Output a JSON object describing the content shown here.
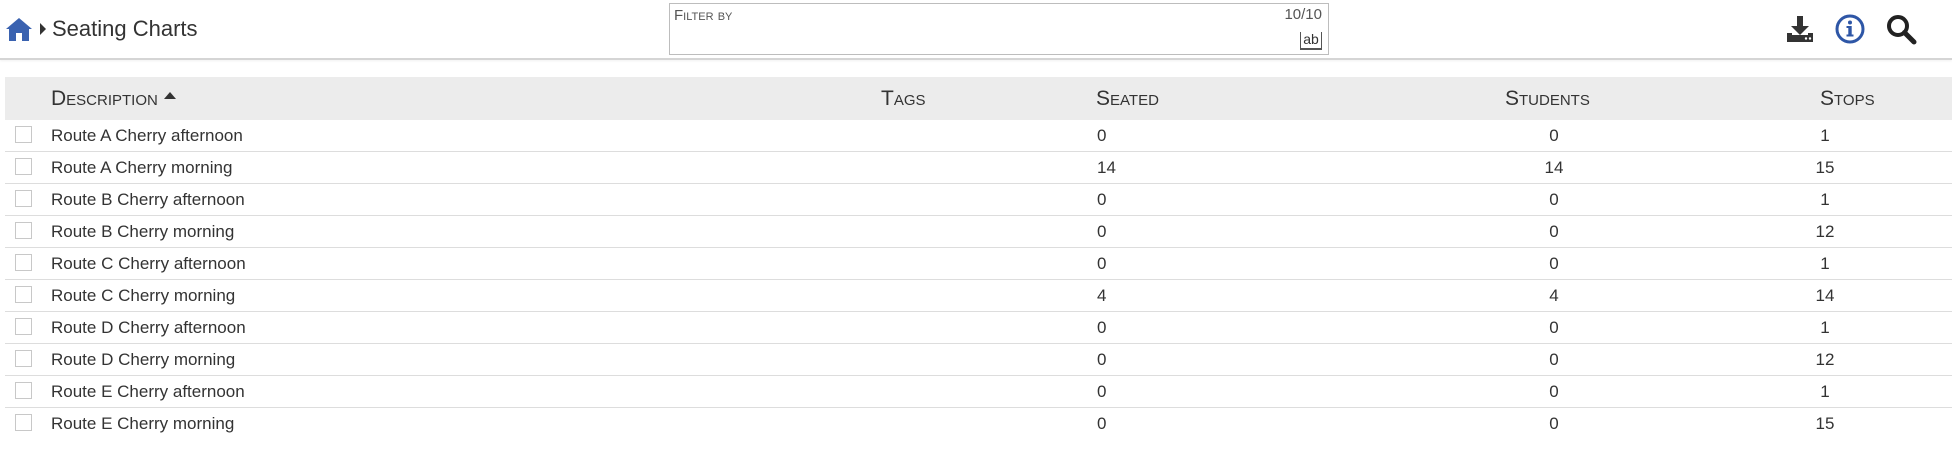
{
  "breadcrumb": {
    "home_icon": "home-icon",
    "separator_icon": "caret-right-icon",
    "title": "Seating Charts"
  },
  "filter": {
    "label": "Filter by",
    "count": "10/10",
    "value": "",
    "mode_icon": "match-case-ab-icon",
    "mode_text": "ab"
  },
  "toolbar": {
    "icons": [
      "download-icon",
      "info-icon",
      "search-icon"
    ]
  },
  "table": {
    "columns": {
      "description": "Description",
      "tags": "Tags",
      "seated": "Seated",
      "students": "Students",
      "stops": "Stops"
    },
    "sort": {
      "column": "description",
      "direction": "ascending"
    },
    "rows": [
      {
        "description": "Route A Cherry afternoon",
        "tags": "",
        "seated": "0",
        "students": "0",
        "stops": "1"
      },
      {
        "description": "Route A Cherry morning",
        "tags": "",
        "seated": "14",
        "students": "14",
        "stops": "15"
      },
      {
        "description": "Route B Cherry afternoon",
        "tags": "",
        "seated": "0",
        "students": "0",
        "stops": "1"
      },
      {
        "description": "Route B Cherry morning",
        "tags": "",
        "seated": "0",
        "students": "0",
        "stops": "12"
      },
      {
        "description": "Route C Cherry afternoon",
        "tags": "",
        "seated": "0",
        "students": "0",
        "stops": "1"
      },
      {
        "description": "Route C Cherry morning",
        "tags": "",
        "seated": "4",
        "students": "4",
        "stops": "14"
      },
      {
        "description": "Route D Cherry afternoon",
        "tags": "",
        "seated": "0",
        "students": "0",
        "stops": "1"
      },
      {
        "description": "Route D Cherry morning",
        "tags": "",
        "seated": "0",
        "students": "0",
        "stops": "12"
      },
      {
        "description": "Route E Cherry afternoon",
        "tags": "",
        "seated": "0",
        "students": "0",
        "stops": "1"
      },
      {
        "description": "Route E Cherry morning",
        "tags": "",
        "seated": "0",
        "students": "0",
        "stops": "15"
      }
    ]
  },
  "colors": {
    "home": "#3a62b0",
    "info": "#2e56a6",
    "header_bg": "#ececec",
    "text": "#333333"
  }
}
